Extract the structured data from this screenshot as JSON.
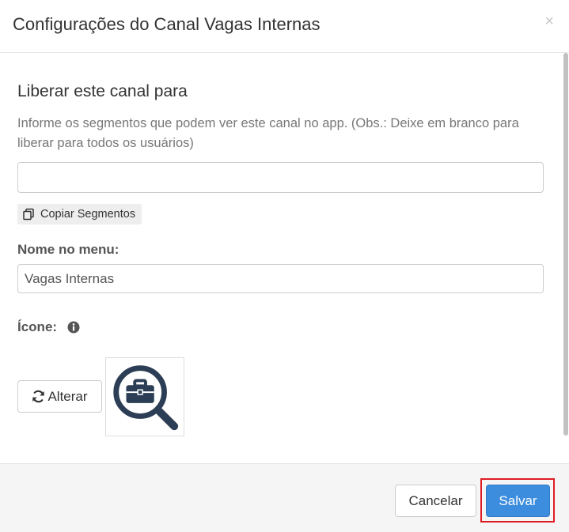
{
  "modal": {
    "title": "Configurações do Canal Vagas Internas",
    "close_symbol": "×"
  },
  "body": {
    "section_title": "Liberar este canal para",
    "help_text": "Informe os segmentos que podem ver este canal no app. (Obs.: Deixe em branco para liberar para todos os usuários)",
    "segments_input": {
      "value": "",
      "placeholder": ""
    },
    "copy_button": {
      "label": "Copiar Segmentos",
      "icon": "copy-icon"
    },
    "menu_name": {
      "label": "Nome no menu:",
      "value": "Vagas Internas"
    },
    "icon_field": {
      "label": "Ícone:",
      "info_icon": "info-circle-icon",
      "change_button": {
        "label": "Alterar",
        "icon": "refresh-icon"
      },
      "preview_icon": "briefcase-search-icon"
    }
  },
  "footer": {
    "cancel_label": "Cancelar",
    "save_label": "Salvar"
  },
  "colors": {
    "primary": "#3c8dde",
    "highlight": "#e01b24",
    "icon_dark": "#2c3e55"
  }
}
